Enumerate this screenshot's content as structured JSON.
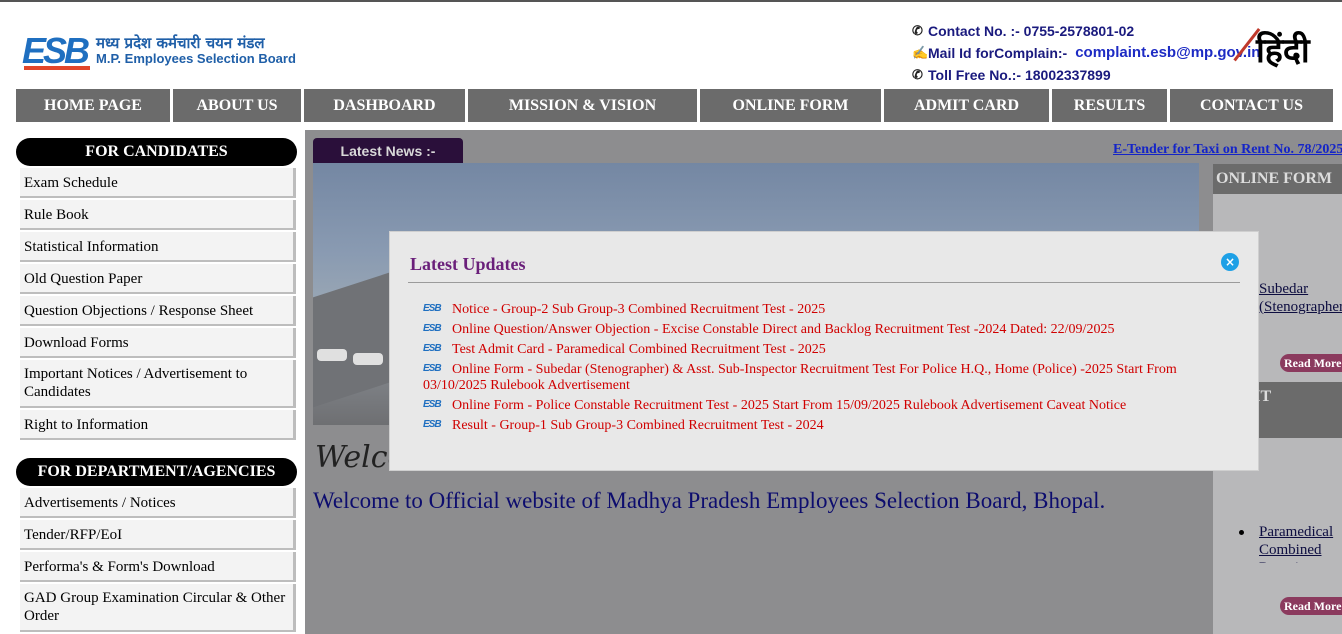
{
  "header": {
    "logo_letters": "ESB",
    "logo_hindi": "मध्य प्रदेश कर्मचारी चयन मंडल",
    "logo_english": "M.P. Employees Selection Board",
    "contact": "Contact No. :- 0755-2578801-02",
    "mail_label": "Mail Id forComplain:-",
    "mail_value": "complaint.esb@mp.gov.in",
    "toll_free": "Toll Free No.:- 18002337899",
    "hindi_label": "हिंदी"
  },
  "nav": [
    {
      "label": "HOME PAGE",
      "w": 157
    },
    {
      "label": "ABOUT US",
      "w": 131
    },
    {
      "label": "DASHBOARD",
      "w": 164
    },
    {
      "label": "MISSION & VISION",
      "w": 232
    },
    {
      "label": "ONLINE FORM",
      "w": 184
    },
    {
      "label": "ADMIT CARD",
      "w": 168
    },
    {
      "label": "RESULTS",
      "w": 118
    },
    {
      "label": "CONTACT US",
      "w": 166
    }
  ],
  "sidebar": {
    "candidates_title": "FOR CANDIDATES",
    "candidates": [
      "Exam Schedule",
      "Rule Book",
      "Statistical Information",
      "Old Question Paper",
      "Question Objections / Response Sheet",
      "Download Forms",
      "Important Notices / Advertisement to Candidates",
      "Right to Information"
    ],
    "department_title": "FOR DEPARTMENT/AGENCIES",
    "department": [
      "Advertisements / Notices",
      "Tender/RFP/EoI",
      "Performa's & Form's Download",
      "GAD Group Examination Circular & Other Order"
    ]
  },
  "news": {
    "label": "Latest News :-",
    "ticker": "E-Tender for Taxi on Rent No. 78/2025"
  },
  "welcome": {
    "script": "Welcome",
    "text": "Welcome to Official website of Madhya Pradesh Employees Selection Board, Bhopal."
  },
  "right_panel": {
    "online_form_title": "ONLINE FORM",
    "online_form_item": "Subedar (Stenographer) & Asst. Sub",
    "read_more": "Read More",
    "admit_title": "ADMIT",
    "admit_item": "Paramedical Combined Recruitment",
    "read_more_2": "Read More"
  },
  "modal": {
    "title": "Latest Updates",
    "close_icon": "×",
    "updates": [
      "Notice - Group-2 Sub Group-3 Combined Recruitment Test - 2025",
      "Online Question/Answer Objection - Excise Constable Direct and Backlog Recruitment Test -2024   Dated: 22/09/2025",
      "Test Admit Card - Paramedical Combined Recruitment Test - 2025",
      "Online Form - Subedar (Stenographer) & Asst. Sub-Inspector  Recruitment Test For Police H.Q., Home (Police) -2025 Start From 03/10/2025  Rulebook   Advertisement",
      "Online Form - Police Constable Recruitment Test - 2025 Start From 15/09/2025  Rulebook  Advertisement   Caveat Notice",
      "Result - Group-1 Sub Group-3 Combined Recruitment Test - 2024"
    ]
  },
  "colors": {
    "nav_bg": "#6b6b6b",
    "modal_title": "#6a1f7a",
    "update_link": "#d00000",
    "accent_blue": "#1f6fc0"
  }
}
